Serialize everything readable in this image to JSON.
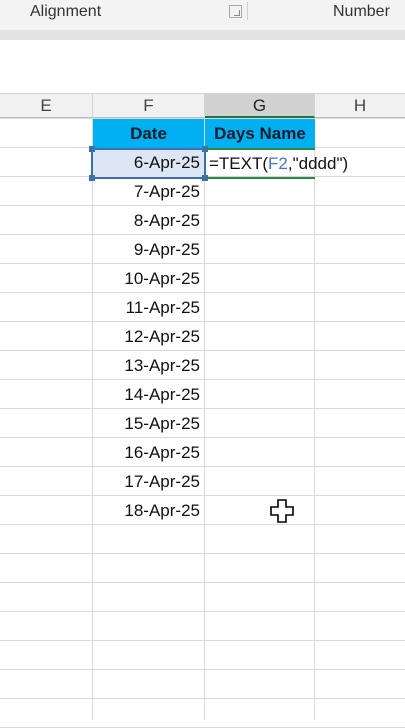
{
  "ribbon": {
    "alignment_label": "Alignment",
    "number_label": "Number"
  },
  "columns": [
    {
      "label": "E"
    },
    {
      "label": "F"
    },
    {
      "label": "G"
    },
    {
      "label": "H"
    }
  ],
  "table": {
    "header_date": "Date",
    "header_days": "Days Name",
    "dates": [
      "6-Apr-25",
      "7-Apr-25",
      "8-Apr-25",
      "9-Apr-25",
      "10-Apr-25",
      "11-Apr-25",
      "12-Apr-25",
      "13-Apr-25",
      "14-Apr-25",
      "15-Apr-25",
      "16-Apr-25",
      "17-Apr-25",
      "18-Apr-25"
    ]
  },
  "formula": {
    "prefix": "=TEXT(",
    "ref": "F2",
    "suffix": ",\"dddd\")"
  },
  "colors": {
    "header_fill": "#00b0f0",
    "selection": "#3b6fb6",
    "active_cell_border": "#2b8a3e",
    "reference": "#4a6fd6"
  },
  "icons": {
    "cursor": "cell-select-cross-icon",
    "dialog_launcher": "dialog-launcher-icon"
  }
}
